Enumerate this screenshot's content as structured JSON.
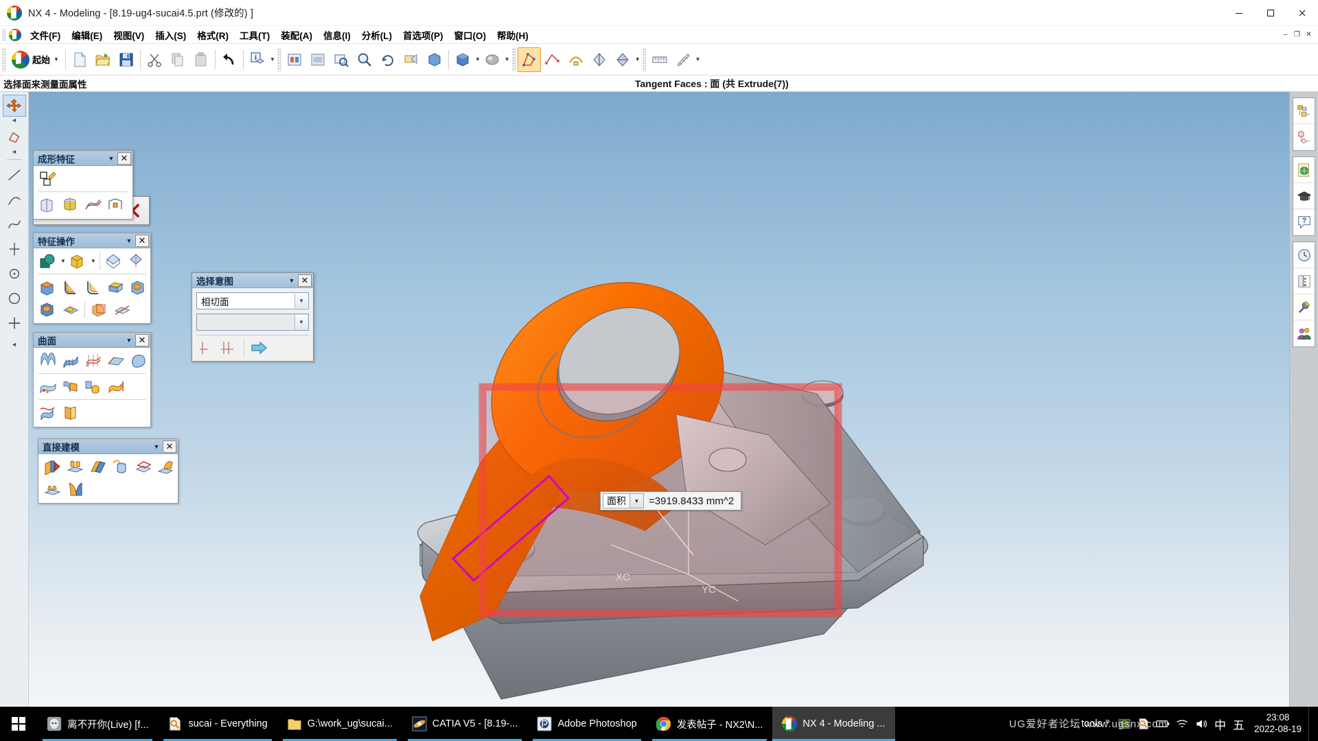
{
  "window": {
    "title": "NX 4 - Modeling - [8.19-ug4-sucai4.5.prt  (修改的)  ]",
    "app_icon": "nx-logo-icon",
    "minimize": "minimize-icon",
    "maximize": "maximize-icon",
    "close": "close-icon"
  },
  "menubar": {
    "items": [
      {
        "label": "文件(F)",
        "name": "menu-file"
      },
      {
        "label": "编辑(E)",
        "name": "menu-edit"
      },
      {
        "label": "视图(V)",
        "name": "menu-view"
      },
      {
        "label": "插入(S)",
        "name": "menu-insert"
      },
      {
        "label": "格式(R)",
        "name": "menu-format"
      },
      {
        "label": "工具(T)",
        "name": "menu-tools"
      },
      {
        "label": "装配(A)",
        "name": "menu-assemblies"
      },
      {
        "label": "信息(I)",
        "name": "menu-information"
      },
      {
        "label": "分析(L)",
        "name": "menu-analysis"
      },
      {
        "label": "首选项(P)",
        "name": "menu-preferences"
      },
      {
        "label": "窗口(O)",
        "name": "menu-window"
      },
      {
        "label": "帮助(H)",
        "name": "menu-help"
      }
    ],
    "doc_minimize": "–",
    "doc_restore": "❐",
    "doc_close": "✕"
  },
  "toolbar": {
    "start_label": "起始",
    "buttons": [
      {
        "name": "new-button",
        "icon": "new-document-icon"
      },
      {
        "name": "open-button",
        "icon": "open-folder-icon"
      },
      {
        "name": "save-button",
        "icon": "floppy-save-icon"
      },
      {
        "name": "cut-button",
        "icon": "scissors-icon"
      },
      {
        "name": "copy-button",
        "icon": "copy-icon"
      },
      {
        "name": "paste-button",
        "icon": "paste-icon"
      },
      {
        "name": "undo-button",
        "icon": "undo-arrow-icon"
      },
      {
        "name": "info-object-button",
        "icon": "info-object-icon"
      }
    ]
  },
  "status": {
    "cue": "选择面来测量面属性",
    "selection": "Tangent Faces : 面  (共 Extrude(7))"
  },
  "measure_toolbar": {
    "name": "measure-toolbar",
    "buttons": [
      {
        "name": "measure-distance-button",
        "icon": "p1p2-distance-icon"
      },
      {
        "name": "measure-angle-button",
        "icon": "angle-measure-icon"
      },
      {
        "name": "measure-info-button",
        "icon": "info-blue-icon"
      },
      {
        "name": "measure-close-button",
        "icon": "red-x-icon"
      }
    ]
  },
  "selection_intent": {
    "title": "选择意图",
    "rule_value": "相切面",
    "secondary_value": "",
    "arrow_icon": "chevron-down-icon",
    "close_icon": "close-x-icon",
    "buttons": [
      {
        "name": "si-single-button",
        "icon": "single-curve-icon"
      },
      {
        "name": "si-chain-button",
        "icon": "chain-curve-icon"
      },
      {
        "name": "si-apply-button",
        "icon": "blue-arrow-right-icon"
      }
    ]
  },
  "palettes": [
    {
      "name": "palette-form-features",
      "title": "成形特征",
      "rows": [
        [
          {
            "name": "sketch-button",
            "icon": "sketch-icon"
          }
        ],
        [
          {
            "name": "extrude-button",
            "icon": "extrude-icon"
          },
          {
            "name": "revolve-button",
            "icon": "revolve-icon"
          },
          {
            "name": "sweep-button",
            "icon": "sweep-icon"
          },
          {
            "name": "tube-button",
            "icon": "tube-icon"
          }
        ]
      ]
    },
    {
      "name": "palette-feature-operations",
      "title": "特征操作",
      "rows": [
        [
          {
            "name": "unite-button",
            "icon": "boolean-unite-icon"
          },
          {
            "name": "trim-body-button",
            "icon": "trim-body-icon"
          },
          {
            "name": "instance-button",
            "icon": "instance-icon"
          },
          {
            "name": "mirror-feature-button",
            "icon": "mirror-feature-icon"
          }
        ],
        [
          {
            "name": "edge-blend-button",
            "icon": "edge-blend-icon"
          },
          {
            "name": "face-blend-button",
            "icon": "face-blend-icon"
          },
          {
            "name": "soft-blend-button",
            "icon": "soft-blend-icon"
          },
          {
            "name": "chamfer-button",
            "icon": "chamfer-icon"
          },
          {
            "name": "hollow-button",
            "icon": "hollow-icon"
          }
        ],
        [
          {
            "name": "thread-button",
            "icon": "thread-icon"
          },
          {
            "name": "dimple-button",
            "icon": "dimple-icon"
          },
          {
            "name": "scale-body-button",
            "icon": "scale-body-icon"
          },
          {
            "name": "split-body-button",
            "icon": "split-body-icon"
          }
        ]
      ]
    },
    {
      "name": "palette-surface",
      "title": "曲面",
      "rows": [
        [
          {
            "name": "ruled-surface-button",
            "icon": "ruled-surface-icon"
          },
          {
            "name": "through-curves-button",
            "icon": "through-curves-icon"
          },
          {
            "name": "through-curve-mesh-button",
            "icon": "curve-mesh-icon"
          },
          {
            "name": "swept-surface-button",
            "icon": "swept-surface-icon"
          },
          {
            "name": "n-sided-surface-button",
            "icon": "n-sided-surface-icon"
          }
        ],
        [
          {
            "name": "studio-surface-button",
            "icon": "studio-surface-icon"
          },
          {
            "name": "extrude-sheet-button",
            "icon": "extrude-sheet-icon"
          },
          {
            "name": "revolve-sheet-button",
            "icon": "revolve-sheet-icon"
          },
          {
            "name": "offset-surface-button",
            "icon": "offset-surface-icon"
          }
        ],
        [
          {
            "name": "trim-sheet-button",
            "icon": "trim-sheet-icon"
          },
          {
            "name": "thicken-sheet-button",
            "icon": "thicken-sheet-icon"
          }
        ]
      ]
    },
    {
      "name": "palette-direct-modeling",
      "title": "直接建模",
      "rows": [
        [
          {
            "name": "move-face-button",
            "icon": "move-face-icon"
          },
          {
            "name": "resize-face-button",
            "icon": "resize-face-icon"
          },
          {
            "name": "offset-region-button",
            "icon": "offset-region-icon"
          },
          {
            "name": "replace-face-button",
            "icon": "replace-face-icon"
          },
          {
            "name": "delete-face-button",
            "icon": "delete-face-icon"
          },
          {
            "name": "copy-face-button",
            "icon": "copy-face-icon"
          }
        ],
        [
          {
            "name": "resize-blend-button",
            "icon": "resize-blend-icon"
          },
          {
            "name": "face-taper-button",
            "icon": "face-taper-icon"
          }
        ]
      ]
    }
  ],
  "measurement": {
    "label": "面积",
    "arrow_icon": "chevron-down-icon",
    "value": "=3919.8433 mm^2"
  },
  "viewport": {
    "triad_x": "XC",
    "triad_y": "YC",
    "highlight_color": "#ff6600",
    "selection_rect_color": "#f04444",
    "edge_highlight_color": "#cc00cc",
    "body_color": "#b9bcc0",
    "background_top": "#7ea9cd",
    "background_bottom": "#f3f6f8"
  },
  "right_rail": {
    "groups": [
      [
        {
          "name": "rail-part-navigator",
          "icon": "part-navigator-icon"
        },
        {
          "name": "rail-constraint-navigator",
          "icon": "constraint-navigator-icon"
        }
      ],
      [
        {
          "name": "rail-web-browser",
          "icon": "web-page-icon"
        },
        {
          "name": "rail-learning",
          "icon": "graduation-cap-icon"
        },
        {
          "name": "rail-help",
          "icon": "question-balloon-icon"
        }
      ],
      [
        {
          "name": "rail-history",
          "icon": "clock-history-icon"
        },
        {
          "name": "rail-palette",
          "icon": "palette-panel-icon"
        },
        {
          "name": "rail-roles",
          "icon": "roles-tools-icon"
        },
        {
          "name": "rail-collaborate",
          "icon": "two-people-icon"
        }
      ]
    ]
  },
  "left_rail": {
    "items": [
      {
        "name": "rail-selection-cursor",
        "icon": "move-cursor-icon"
      },
      {
        "name": "rail-face-finder",
        "icon": "face-find-icon"
      },
      {
        "name": "rail-line-tool",
        "icon": "line-icon"
      },
      {
        "name": "rail-arc-tool",
        "icon": "arc-icon"
      },
      {
        "name": "rail-curve-tool",
        "icon": "curve-icon"
      },
      {
        "name": "rail-datum-tool",
        "icon": "datum-axis-icon"
      },
      {
        "name": "rail-point-tool",
        "icon": "point-icon"
      },
      {
        "name": "rail-circle-tool",
        "icon": "circle-icon"
      },
      {
        "name": "rail-plus-tool",
        "icon": "plus-icon"
      }
    ]
  },
  "taskbar": {
    "start_icon": "windows-start-icon",
    "tasks": [
      {
        "name": "task-music-player",
        "label": "离不开你(Live)  [f...",
        "icon": "media-player-icon",
        "active": false
      },
      {
        "name": "task-everything",
        "label": "sucai - Everything",
        "icon": "everything-search-icon",
        "active": false
      },
      {
        "name": "task-explorer",
        "label": "G:\\work_ug\\sucai...",
        "icon": "folder-icon",
        "active": false
      },
      {
        "name": "task-catia",
        "label": "CATIA V5 - [8.19-...",
        "icon": "catia-icon",
        "active": false
      },
      {
        "name": "task-photoshop",
        "label": "Adobe Photoshop",
        "icon": "photoshop-icon",
        "active": false
      },
      {
        "name": "task-chrome",
        "label": "发表帖子 - NX2\\N...",
        "icon": "chrome-icon",
        "active": false
      },
      {
        "name": "task-nx",
        "label": "NX 4 - Modeling ...",
        "icon": "nx-logo-icon",
        "active": true
      }
    ],
    "tray_label": "tools",
    "tray_overflow": "»",
    "tray_icons": [
      {
        "name": "tray-nvidia",
        "icon": "nvidia-icon"
      },
      {
        "name": "tray-everything",
        "icon": "everything-search-icon"
      },
      {
        "name": "tray-battery",
        "icon": "battery-icon"
      },
      {
        "name": "tray-wifi",
        "icon": "wifi-icon"
      },
      {
        "name": "tray-volume",
        "icon": "speaker-icon"
      }
    ],
    "ime_mode": "中",
    "ime_extra": "五",
    "clock_time": "23:08",
    "clock_date": "2022-08-19"
  },
  "watermark": "UG爱好者论坛 www.ugsnx.com"
}
